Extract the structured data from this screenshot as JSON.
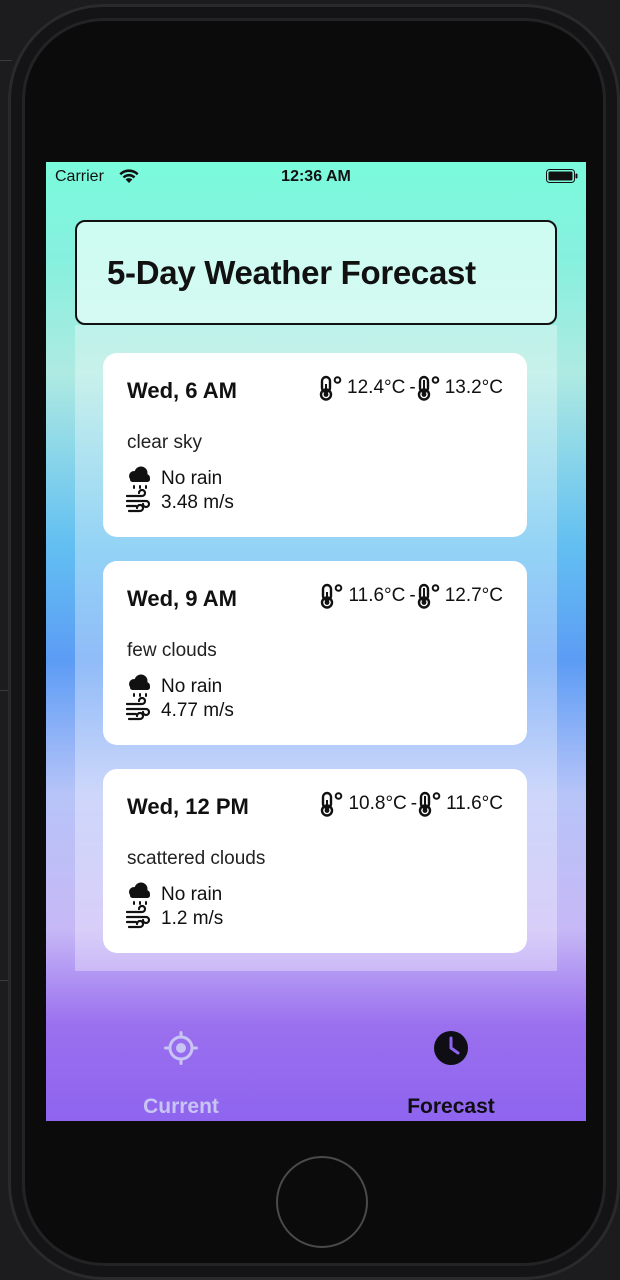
{
  "status_bar": {
    "carrier": "Carrier",
    "time": "12:36 AM",
    "wifi_icon": "wifi-icon",
    "battery_icon": "battery-icon"
  },
  "header": {
    "title": "5-Day Weather Forecast"
  },
  "forecast": [
    {
      "day": "Wed, 6 AM",
      "temp_min": "12.4°C",
      "temp_max": "13.2°C",
      "separator": "-",
      "description": "clear sky",
      "rain": "No rain",
      "wind": "3.48 m/s"
    },
    {
      "day": "Wed, 9 AM",
      "temp_min": "11.6°C",
      "temp_max": "12.7°C",
      "separator": "-",
      "description": "few clouds",
      "rain": "No rain",
      "wind": "4.77 m/s"
    },
    {
      "day": "Wed, 12 PM",
      "temp_min": "10.8°C",
      "temp_max": "11.6°C",
      "separator": "-",
      "description": "scattered clouds",
      "rain": "No rain",
      "wind": "1.2 m/s"
    }
  ],
  "tab_bar": {
    "current": {
      "label": "Current",
      "icon": "location-target-icon",
      "selected": false
    },
    "forecast": {
      "label": "Forecast",
      "icon": "clock-icon",
      "selected": true
    }
  },
  "colors": {
    "gradient_top": "#7afbdc",
    "gradient_mid": "#5c9cf5",
    "gradient_bottom": "#8f64ef",
    "tab_inactive": "#c8c4f4",
    "tab_active": "#0e0e14"
  }
}
